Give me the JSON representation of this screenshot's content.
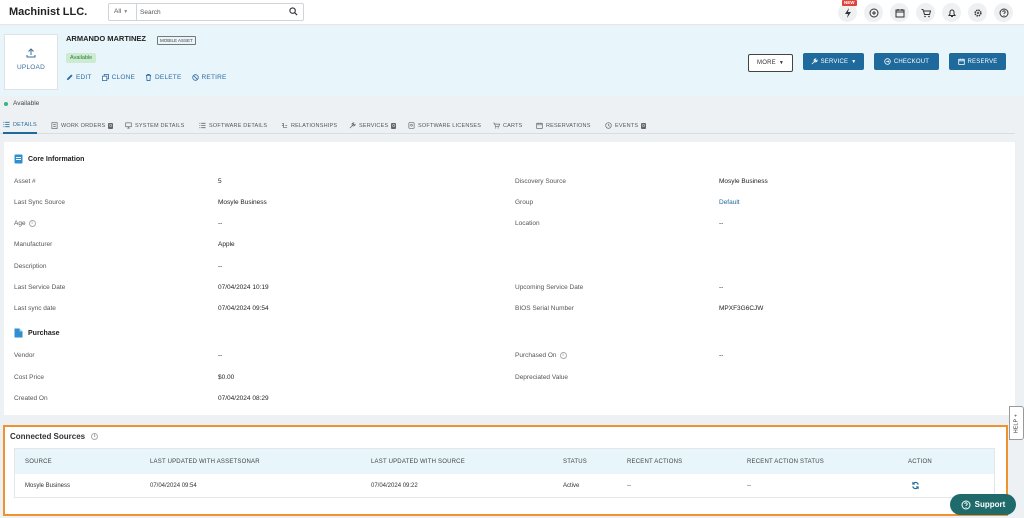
{
  "app": {
    "brand": "Machinist LLC."
  },
  "search": {
    "category": "All",
    "placeholder": "Search"
  },
  "top_icons": [
    "lightning-icon",
    "plus-circle-icon",
    "calendar-icon",
    "cart-icon",
    "bell-icon",
    "gear-icon",
    "help-icon"
  ],
  "new_badge": "NEW",
  "asset": {
    "upload_label": "UPLOAD",
    "owner": "ARMANDO MARTINEZ",
    "type_badge": "MOBILE ASSET",
    "availability": "Available",
    "actions": {
      "edit": "EDIT",
      "clone": "CLONE",
      "delete": "DELETE",
      "retire": "RETIRE"
    }
  },
  "buttons": {
    "more": "MORE",
    "service": "SERVICE",
    "checkout": "CHECKOUT",
    "reserve": "RESERVE"
  },
  "status_line": "Available",
  "tabs": [
    {
      "label": "DETAILS",
      "icon": "list-icon"
    },
    {
      "label": "WORK ORDERS",
      "icon": "work-order-icon",
      "count": "0"
    },
    {
      "label": "SYSTEM DETAILS",
      "icon": "monitor-icon"
    },
    {
      "label": "SOFTWARE DETAILS",
      "icon": "list-icon"
    },
    {
      "label": "RELATIONSHIPS",
      "icon": "relationships-icon"
    },
    {
      "label": "SERVICES",
      "icon": "wrench-icon",
      "count": "0"
    },
    {
      "label": "SOFTWARE LICENSES",
      "icon": "license-icon"
    },
    {
      "label": "CARTS",
      "icon": "cart-icon"
    },
    {
      "label": "RESERVATIONS",
      "icon": "calendar-icon"
    },
    {
      "label": "EVENTS",
      "icon": "events-icon",
      "count": "0"
    }
  ],
  "core": {
    "title": "Core Information",
    "asset_no": {
      "label": "Asset #",
      "value": "5"
    },
    "last_sync_source": {
      "label": "Last Sync Source",
      "value": "Mosyle Business"
    },
    "age": {
      "label": "Age",
      "value": "--"
    },
    "manufacturer": {
      "label": "Manufacturer",
      "value": "Apple"
    },
    "description": {
      "label": "Description",
      "value": "--"
    },
    "last_service_date": {
      "label": "Last Service Date",
      "value": "07/04/2024 10:19"
    },
    "last_sync_date": {
      "label": "Last sync date",
      "value": "07/04/2024 09:54"
    },
    "discovery_source": {
      "label": "Discovery Source",
      "value": "Mosyle Business"
    },
    "group": {
      "label": "Group",
      "value": "Default"
    },
    "location": {
      "label": "Location",
      "value": "--"
    },
    "upcoming_service_date": {
      "label": "Upcoming Service Date",
      "value": "--"
    },
    "bios_serial": {
      "label": "BIOS Serial Number",
      "value": "MPXF3G6CJW"
    }
  },
  "purchase": {
    "title": "Purchase",
    "vendor": {
      "label": "Vendor",
      "value": "--"
    },
    "cost_price": {
      "label": "Cost Price",
      "value": "$0.00"
    },
    "created_on": {
      "label": "Created On",
      "value": "07/04/2024 08:29"
    },
    "purchased_on": {
      "label": "Purchased On",
      "value": "--"
    },
    "depreciated_value": {
      "label": "Depreciated Value",
      "value": ""
    }
  },
  "connected_sources": {
    "title": "Connected Sources",
    "columns": [
      "SOURCE",
      "LAST UPDATED WITH ASSETSONAR",
      "LAST UPDATED WITH SOURCE",
      "STATUS",
      "RECENT ACTIONS",
      "RECENT ACTION STATUS",
      "ACTION"
    ],
    "rows": [
      [
        "Mosyle Business",
        "07/04/2024 09:54",
        "07/04/2024 09:22",
        "Active",
        "--",
        "--"
      ]
    ]
  },
  "help_tab": "HELP +",
  "support": "Support"
}
